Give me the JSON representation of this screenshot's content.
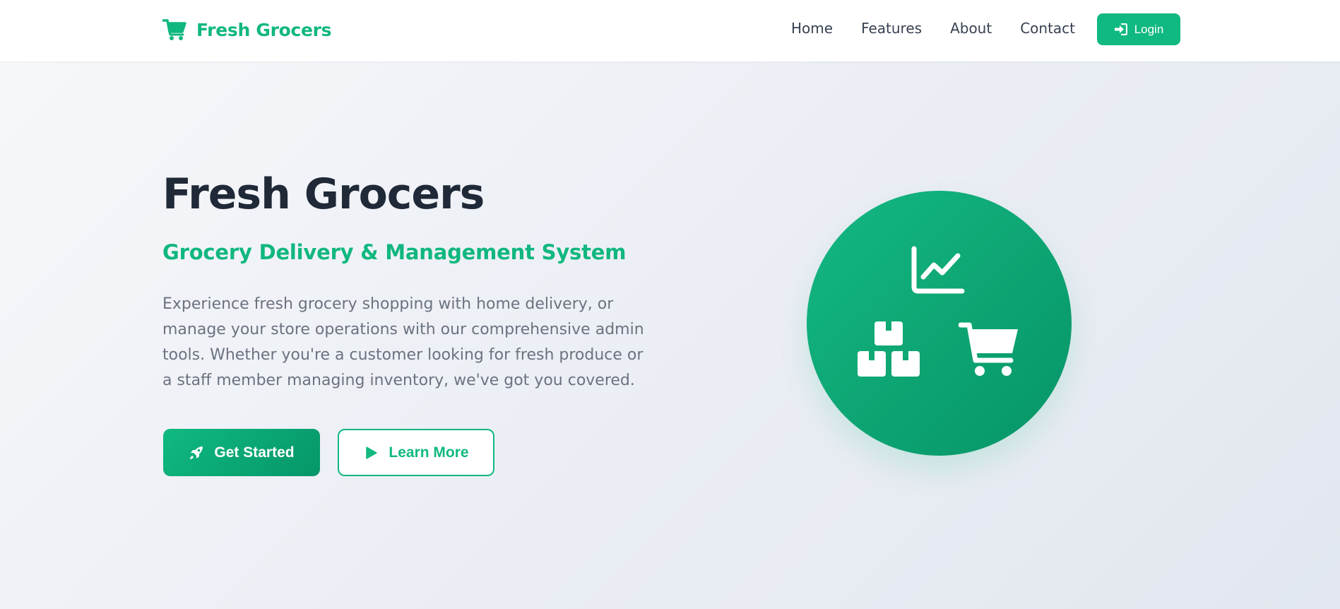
{
  "nav": {
    "brand": "Fresh Grocers",
    "links": [
      "Home",
      "Features",
      "About",
      "Contact"
    ],
    "login_label": "Login"
  },
  "hero": {
    "title": "Fresh Grocers",
    "subtitle": "Grocery Delivery & Management System",
    "description": "Experience fresh grocery shopping with home delivery, or manage your store operations with our comprehensive admin tools. Whether you're a customer looking for fresh produce or a staff member managing inventory, we've got you covered.",
    "primary_button": "Get Started",
    "secondary_button": "Learn More"
  },
  "icons": {
    "brand": "cart-icon",
    "login": "sign-in-icon",
    "primary": "rocket-icon",
    "secondary": "play-icon",
    "illustration": [
      "chart-line-icon",
      "boxes-icon",
      "cart-icon"
    ]
  },
  "colors": {
    "accent": "#10b981",
    "accent_dark": "#059669",
    "heading": "#1f2937",
    "body_text": "#6b7280",
    "nav_text": "#374151"
  }
}
